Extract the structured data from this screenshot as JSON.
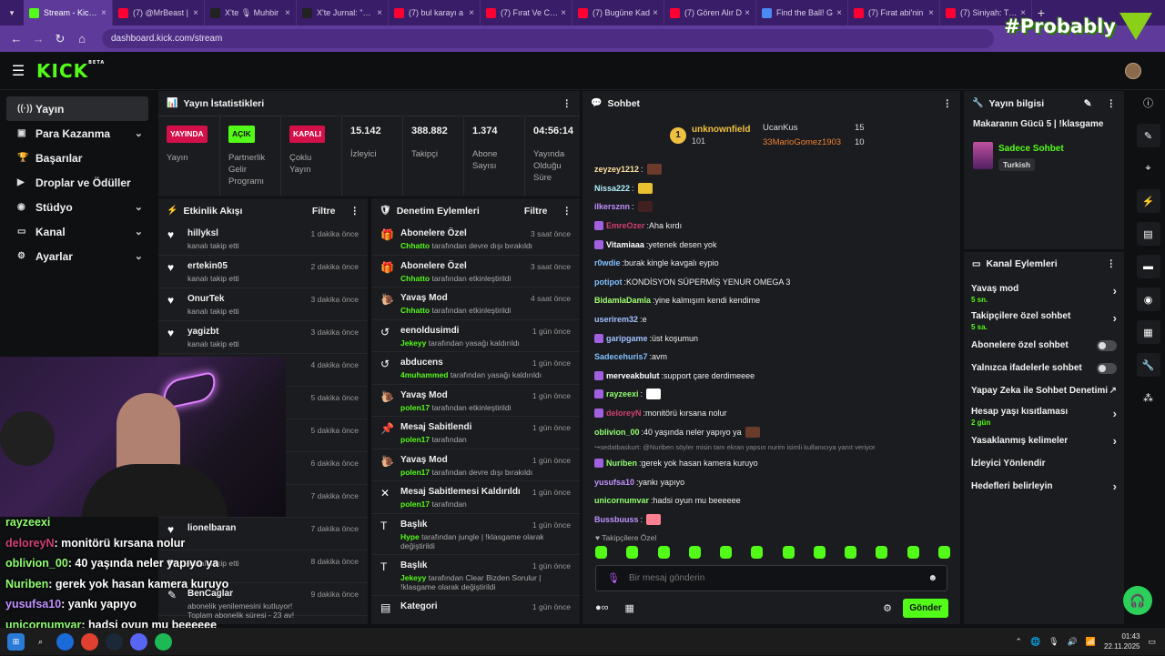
{
  "browser": {
    "tabs": [
      {
        "title": "Stream - Kick D",
        "color": "#53fc18",
        "active": true
      },
      {
        "title": "(7) @MrBeast |",
        "color": "#ff0033"
      },
      {
        "title": "X'te 🎙 Muhbir",
        "color": "#222"
      },
      {
        "title": "X'te Jurnal: \"Ora",
        "color": "#222"
      },
      {
        "title": "(7) bul karayı a",
        "color": "#ff0033"
      },
      {
        "title": "(7) Fırat Ve Cey",
        "color": "#ff0033"
      },
      {
        "title": "(7) Bugüne Kad",
        "color": "#ff0033"
      },
      {
        "title": "(7) Gören Alır D",
        "color": "#ff0033"
      },
      {
        "title": "Find the Ball! G",
        "color": "#4a8af4"
      },
      {
        "title": "(7) Fırat abi'nin",
        "color": "#ff0033"
      },
      {
        "title": "(7) Siniyah: The",
        "color": "#ff0033"
      }
    ],
    "url": "dashboard.kick.com/stream",
    "watermark": "#Probably"
  },
  "sidebar": {
    "items": [
      {
        "label": "Yayın",
        "icon": "signal-icon",
        "chevron": false
      },
      {
        "label": "Para Kazanma",
        "icon": "money-icon",
        "chevron": true
      },
      {
        "label": "Başarılar",
        "icon": "trophy-icon",
        "chevron": false
      },
      {
        "label": "Droplar ve Ödüller",
        "icon": "drops-icon",
        "chevron": false
      },
      {
        "label": "Stüdyo",
        "icon": "studio-icon",
        "chevron": true
      },
      {
        "label": "Kanal",
        "icon": "channel-icon",
        "chevron": true
      },
      {
        "label": "Ayarlar",
        "icon": "gear-icon",
        "chevron": true
      }
    ]
  },
  "stats": {
    "title": "Yayın İstatistikleri",
    "items": [
      {
        "badge": "YAYINDA",
        "badge_color": "#d4104a",
        "label": "Yayın"
      },
      {
        "badge": "AÇIK",
        "badge_color": "#53fc18",
        "label": "Partnerlik Gelir Programı"
      },
      {
        "badge": "KAPALI",
        "badge_color": "#d4104a",
        "label": "Çoklu Yayın"
      },
      {
        "value": "15.142",
        "label": "İzleyici"
      },
      {
        "value": "388.882",
        "label": "Takipçi"
      },
      {
        "value": "1.374",
        "label": "Abone Sayısı"
      },
      {
        "value": "04:56:14",
        "label": "Yayında Olduğu Süre"
      }
    ]
  },
  "activity": {
    "title": "Etkinlik Akışı",
    "filter": "Filtre",
    "rows": [
      {
        "name": "hillyksl",
        "sub": "kanalı takip etti",
        "time": "1 dakika önce"
      },
      {
        "name": "ertekin05",
        "sub": "kanalı takip etti",
        "time": "2 dakika önce"
      },
      {
        "name": "OnurTek",
        "sub": "kanalı takip etti",
        "time": "3 dakika önce"
      },
      {
        "name": "yagizbt",
        "sub": "kanalı takip etti",
        "time": "3 dakika önce"
      },
      {
        "name": "",
        "sub": "",
        "time": "4 dakika önce"
      },
      {
        "name": "",
        "sub": "",
        "time": "5 dakika önce"
      },
      {
        "name": "",
        "sub": "",
        "time": "5 dakika önce"
      },
      {
        "name": "",
        "sub": "",
        "time": "6 dakika önce"
      },
      {
        "name": "",
        "sub": "",
        "time": "7 dakika önce"
      },
      {
        "name": "lionelbaran",
        "sub": "",
        "time": "7 dakika önce"
      },
      {
        "name": "",
        "sub": "kanalı takip etti",
        "time": "8 dakika önce"
      },
      {
        "name": "BenCaglar",
        "sub": "abonelik yenilemesini kutluyor! Toplam abonelik süresi - 23 av!",
        "time": "9 dakika önce"
      }
    ]
  },
  "moderation": {
    "title": "Denetim Eylemleri",
    "filter": "Filtre",
    "rows": [
      {
        "icon": "gift-icon",
        "name": "Abonelere Özel",
        "actor": "Chhatto",
        "actor_color": "#53fc18",
        "text": "tarafından devre dışı bırakıldı",
        "time": "3 saat önce"
      },
      {
        "icon": "gift-icon",
        "name": "Abonelere Özel",
        "actor": "Chhatto",
        "actor_color": "#53fc18",
        "text": "tarafından etkinleştirildi",
        "time": "3 saat önce"
      },
      {
        "icon": "snail-icon",
        "name": "Yavaş Mod",
        "actor": "Chhatto",
        "actor_color": "#53fc18",
        "text": "tarafından etkinleştirildi",
        "time": "4 saat önce"
      },
      {
        "icon": "undo-icon",
        "name": "eenoldusimdi",
        "actor": "Jekeyy",
        "actor_color": "#53fc18",
        "text": "tarafından yasağı kaldırıldı",
        "time": "1 gün önce"
      },
      {
        "icon": "undo-icon",
        "name": "abducens",
        "actor": "4muhammed",
        "actor_color": "#53fc18",
        "text": "tarafından yasağı kaldırıldı",
        "time": "1 gün önce"
      },
      {
        "icon": "snail-icon",
        "name": "Yavaş Mod",
        "actor": "polen17",
        "actor_color": "#53fc18",
        "text": "tarafından etkinleştirildi",
        "time": "1 gün önce"
      },
      {
        "icon": "pin-icon",
        "name": "Mesaj Sabitlendi",
        "actor": "polen17",
        "actor_color": "#53fc18",
        "text": "tarafından",
        "time": "1 gün önce"
      },
      {
        "icon": "snail-icon",
        "name": "Yavaş Mod",
        "actor": "polen17",
        "actor_color": "#53fc18",
        "text": "tarafından devre dışı bırakıldı",
        "time": "1 gün önce"
      },
      {
        "icon": "unpin-icon",
        "name": "Mesaj Sabitlemesi Kaldırıldı",
        "actor": "polen17",
        "actor_color": "#53fc18",
        "text": "tarafından",
        "time": "1 gün önce"
      },
      {
        "icon": "title-icon",
        "name": "Başlık",
        "actor": "Hype",
        "actor_color": "#53fc18",
        "text": "tarafından jungle | !klasgame olarak değiştirildi",
        "time": "1 gün önce"
      },
      {
        "icon": "title-icon",
        "name": "Başlık",
        "actor": "Jekeyy",
        "actor_color": "#53fc18",
        "text": "tarafından Clear Bizden Sorulur | !klasgame olarak değiştirildi",
        "time": "1 gün önce"
      },
      {
        "icon": "category-icon",
        "name": "Kategori",
        "actor": "",
        "actor_color": "#53fc18",
        "text": "",
        "time": "1 gün önce"
      }
    ]
  },
  "chat": {
    "title": "Sohbet",
    "top_gifter": {
      "name": "unknownfield",
      "count": "101",
      "rank": "1"
    },
    "leaders": [
      {
        "name": "UcanKus",
        "count": "15"
      },
      {
        "name": "33MarioGomez1903",
        "count": "10"
      }
    ],
    "messages": [
      {
        "user": "zeyzey1212",
        "color": "#ffe0a0",
        "text": "",
        "emote": "#6a3a2a"
      },
      {
        "user": "Nissa222",
        "color": "#b0f0ff",
        "text": "",
        "emote": "#e8c030"
      },
      {
        "user": "ilkersznn",
        "color": "#c090ff",
        "text": "",
        "emote": "#402020"
      },
      {
        "user": "EmreOzer",
        "color": "#d04070",
        "text": "Aha kırdı",
        "badge": true
      },
      {
        "user": "Vitamiaaa",
        "color": "#ffffff",
        "text": "yetenek desen yok",
        "badge": true
      },
      {
        "user": "r0wdie",
        "color": "#80c0ff",
        "text": "burak kingle kavgalı eypio"
      },
      {
        "user": "potipot",
        "color": "#80c0ff",
        "text": "KONDİSYON SÜPERMİŞ YENUR OMEGA 3"
      },
      {
        "user": "BidamlaDamla",
        "color": "#a0ff70",
        "text": "yine kalmışım kendi kendime"
      },
      {
        "user": "userirem32",
        "color": "#a0c0ff",
        "text": "e"
      },
      {
        "user": "garipgame",
        "color": "#a0c0ff",
        "text": "üst koşumun",
        "badge": true
      },
      {
        "user": "Sadecehuris7",
        "color": "#80c0ff",
        "text": "avm"
      },
      {
        "user": "merveakbulut",
        "color": "#ffffff",
        "text": "support çare derdimeeee",
        "badge": true
      },
      {
        "user": "rayzeexi",
        "color": "#90ff70",
        "text": "",
        "emote": "#ffffff",
        "badge": true
      },
      {
        "user": "deloreyN",
        "color": "#d04070",
        "text": "monitörü kırsana nolur",
        "badge": true
      },
      {
        "user": "oblivion_00",
        "color": "#90ff70",
        "text": "40 yaşında neler yapıyo ya",
        "emote": "#6a3a2a"
      },
      {
        "user": "Nuriben",
        "color": "#90ff70",
        "text": "gerek yok hasan kamera kuruyo",
        "badge": true,
        "reply": "sedatbaskurt: @Nuriben söyler misin tam ekran yapsın nurim isimli kullanıcıya yanıt veriyor"
      },
      {
        "user": "yusufsa10",
        "color": "#c090ff",
        "text": "yankı yapıyo"
      },
      {
        "user": "unicornumvar",
        "color": "#90ff70",
        "text": "hadsi oyun mu beeeeee"
      },
      {
        "user": "Bussbuuss",
        "color": "#c090ff",
        "text": "",
        "emote": "#ff8090"
      }
    ],
    "followers_only_label": "Takipçilere Özel",
    "input_placeholder": "Bir mesaj gönderin",
    "send_label": "Gönder"
  },
  "stream_info": {
    "title": "Yayın bilgisi",
    "stream_title": "Makaranın Gücü 5 | !klasgame",
    "category": "Sadece Sohbet",
    "language": "Turkish"
  },
  "channel_actions": {
    "title": "Kanal Eylemleri",
    "items": [
      {
        "label": "Yavaş mod",
        "sub": "5 sn.",
        "type": "chevron"
      },
      {
        "label": "Takipçilere özel sohbet",
        "sub": "5 sa.",
        "type": "chevron"
      },
      {
        "label": "Abonelere özel sohbet",
        "type": "toggle"
      },
      {
        "label": "Yalnızca ifadelerle sohbet",
        "type": "toggle"
      },
      {
        "label": "Yapay Zeka ile Sohbet Denetimi",
        "type": "external"
      },
      {
        "label": "Hesap yaşı kısıtlaması",
        "sub": "2 gün",
        "type": "chevron"
      },
      {
        "label": "Yasaklanmış kelimeler",
        "type": "chevron"
      },
      {
        "label": "İzleyici Yönlendir",
        "type": "none"
      },
      {
        "label": "Hedefleri belirleyin",
        "type": "chevron"
      }
    ]
  },
  "overlay_chat": [
    {
      "user": "rayzeexi",
      "color": "#90ff70",
      "text": ""
    },
    {
      "user": "deloreyN",
      "color": "#d04070",
      "text": ": monitörü kırsana nolur"
    },
    {
      "user": "oblivion_00",
      "color": "#90ff70",
      "text": ": 40 yaşında neler yapıyo ya"
    },
    {
      "user": "Nuriben",
      "color": "#90ff70",
      "text": ": gerek yok hasan kamera kuruyo"
    },
    {
      "user": "yusufsa10",
      "color": "#c090ff",
      "text": ": yankı yapıyo"
    },
    {
      "user": "unicornumvar",
      "color": "#90ff70",
      "text": ": hadsi oyun mu beeeeee"
    },
    {
      "user": "Bussbuuss",
      "color": "#c090ff",
      "text": ":"
    }
  ],
  "taskbar": {
    "time": "01:43",
    "date": "22.11.2025"
  }
}
